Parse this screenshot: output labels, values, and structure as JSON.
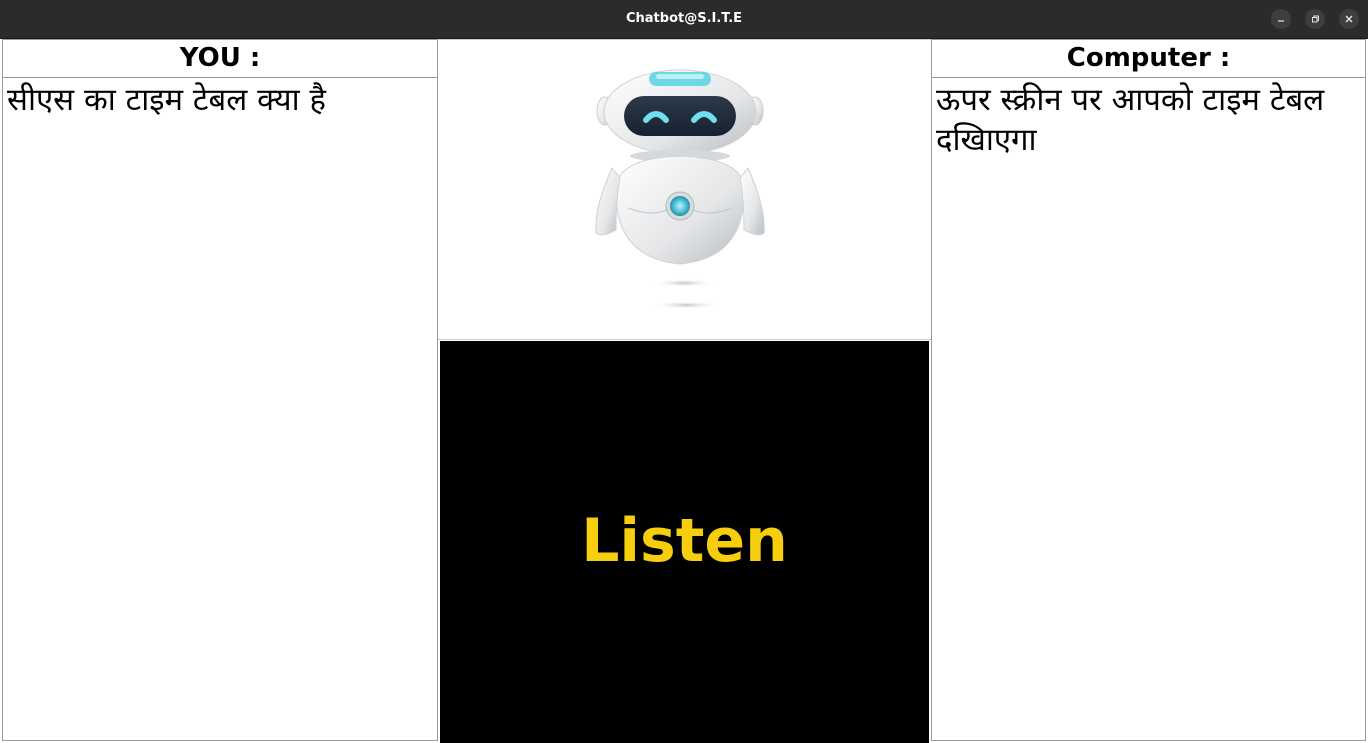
{
  "window": {
    "title": "Chatbot@S.I.T.E",
    "buttons": [
      "minimize",
      "maximize",
      "close"
    ]
  },
  "you_panel": {
    "heading": "YOU :",
    "text": "सीएस का टाइम टेबल क्या है"
  },
  "computer_panel": {
    "heading": "Computer :",
    "text": "ऊपर स्क्रीन पर आपको टाइम टेबल दखिाएगा"
  },
  "center": {
    "image": "robot-assistant-image",
    "listen_label": "Listen"
  },
  "colors": {
    "titlebar": "#2b2b2b",
    "listen_background": "#000000",
    "listen_text": "#f7ce0e",
    "robot_accent": "#5bd0e0"
  }
}
